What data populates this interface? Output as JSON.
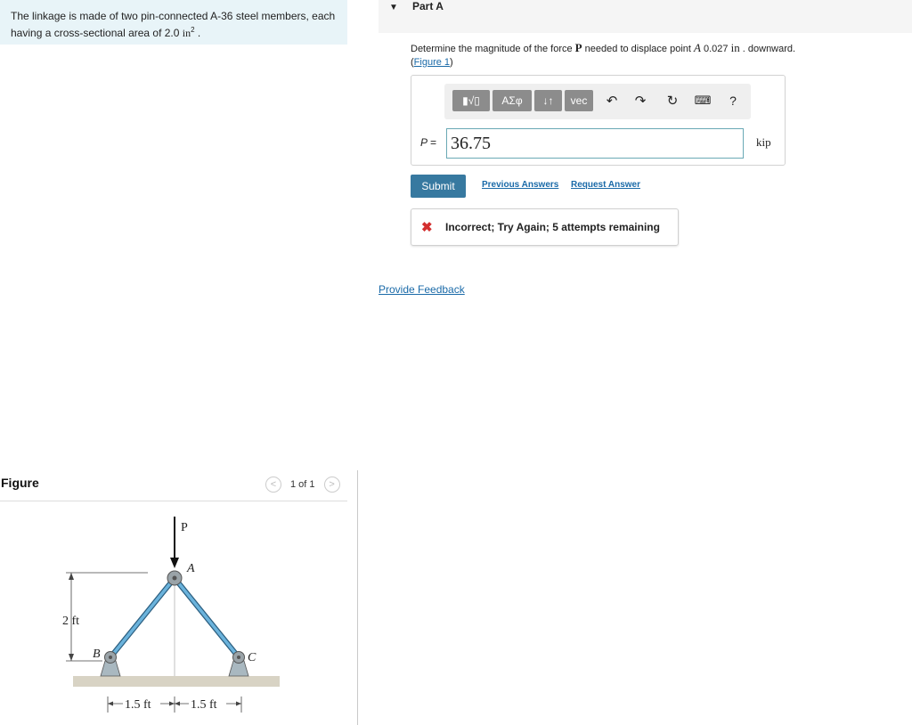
{
  "problem": {
    "text_before": "The linkage is made of two pin-connected A-36 steel members, each having a cross-sectional area of 2.0 ",
    "unit": "in",
    "exponent": "2",
    "text_after": " ."
  },
  "figure_panel": {
    "label": "Figure",
    "prev_symbol": "<",
    "next_symbol": ">",
    "pager": "1 of 1"
  },
  "figure": {
    "load_label": "P",
    "point_a": "A",
    "point_b": "B",
    "point_c": "C",
    "height_label": "2 ft",
    "span_left": "1.5 ft",
    "span_right": "1.5 ft"
  },
  "part": {
    "caret": "▼",
    "title": "Part A"
  },
  "question": {
    "prefix": "Determine the magnitude of the force ",
    "force_symbol": "P",
    "middle": " needed to displace point ",
    "point_symbol": "A",
    "value": " 0.027 ",
    "unit": "in",
    "suffix": " . downward.",
    "figure_link": "Figure 1",
    "paren_open": "(",
    "paren_close": ")"
  },
  "toolbar": {
    "templates": "▮√▯",
    "greek": "ΑΣφ",
    "arrows": "↓↑",
    "vec": "vec",
    "undo": "↶",
    "redo": "↷",
    "reset": "↻",
    "keyboard": "⌨",
    "help": "?"
  },
  "answer": {
    "label": "P =",
    "value": "36.75",
    "unit": "kip"
  },
  "actions": {
    "submit": "Submit",
    "previous_answers": "Previous Answers",
    "request_answer": "Request Answer"
  },
  "feedback": {
    "icon": "✖",
    "message": "Incorrect; Try Again; 5 attempts remaining"
  },
  "footer": {
    "provide_feedback": "Provide Feedback"
  },
  "colors": {
    "accent": "#3779a0",
    "link": "#1a6aa8",
    "error": "#d32f2f",
    "problem_bg": "#e8f4f8",
    "member": "#4d9bc9"
  }
}
